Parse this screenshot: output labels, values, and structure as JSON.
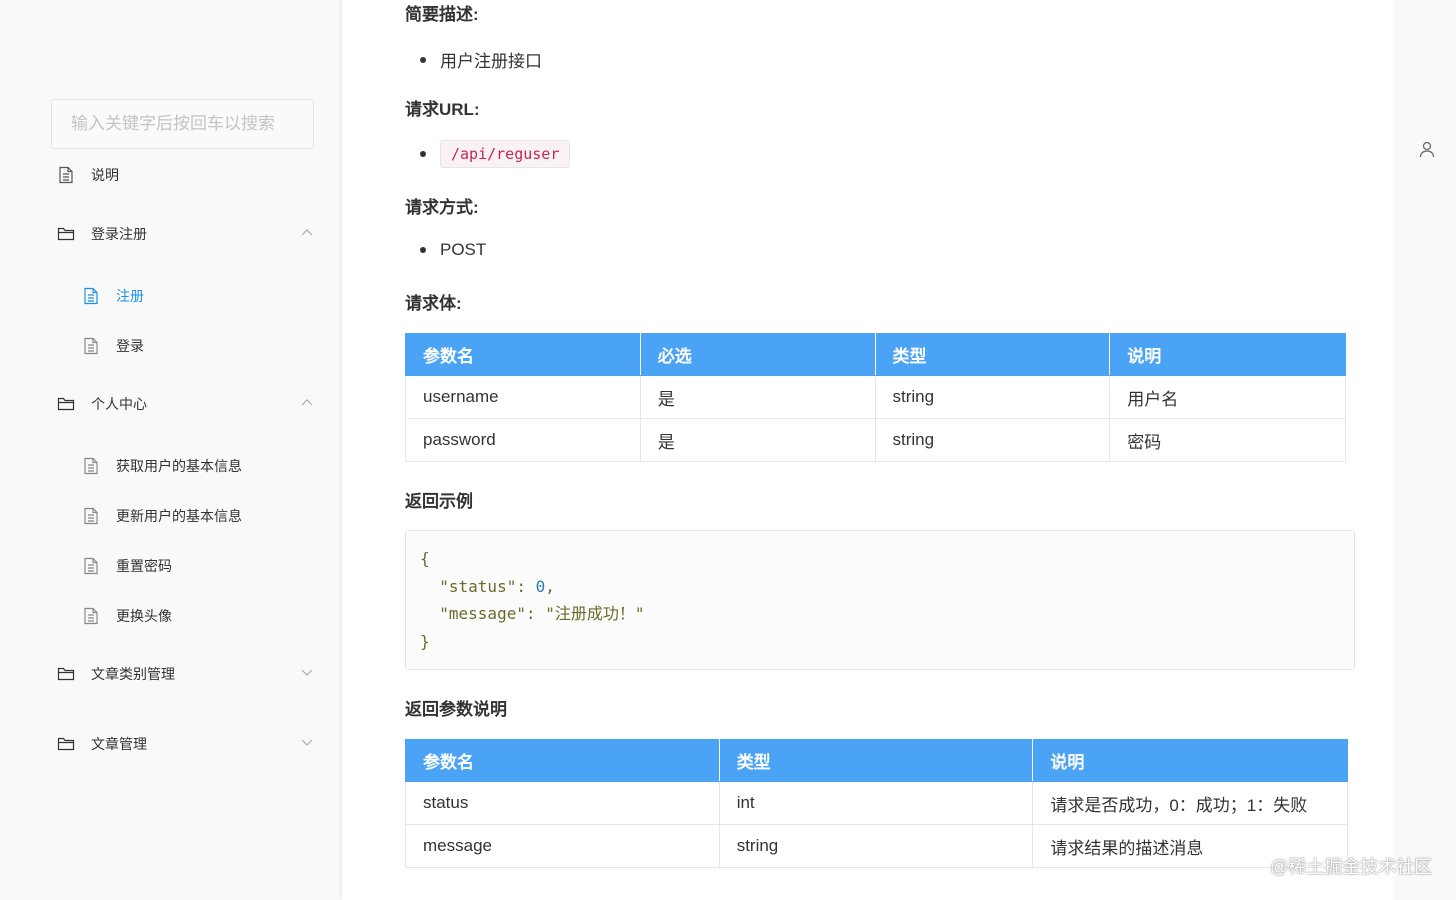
{
  "sidebar": {
    "search_placeholder": "输入关键字后按回车以搜索",
    "items": [
      {
        "label": "说明"
      },
      {
        "label": "登录注册"
      },
      {
        "label": "注册"
      },
      {
        "label": "登录"
      },
      {
        "label": "个人中心"
      },
      {
        "label": "获取用户的基本信息"
      },
      {
        "label": "更新用户的基本信息"
      },
      {
        "label": "重置密码"
      },
      {
        "label": "更换头像"
      },
      {
        "label": "文章类别管理"
      },
      {
        "label": "文章管理"
      }
    ]
  },
  "main": {
    "desc_heading": "简要描述:",
    "desc": "用户注册接口",
    "url_heading": "请求URL:",
    "url": "/api/reguser",
    "method_heading": "请求方式:",
    "method": "POST",
    "body_heading": "请求体:",
    "body_table": {
      "headers": [
        "参数名",
        "必选",
        "类型",
        "说明"
      ],
      "rows": [
        [
          "username",
          "是",
          "string",
          "用户名"
        ],
        [
          "password",
          "是",
          "string",
          "密码"
        ]
      ]
    },
    "example_heading": "返回示例",
    "example_code": {
      "open": "{",
      "l1_key": "  \"status\": ",
      "l1_val": "0",
      "l1_end": ",",
      "l2": "  \"message\": \"注册成功！\"",
      "close": "}"
    },
    "return_heading": "返回参数说明",
    "return_table": {
      "headers": [
        "参数名",
        "类型",
        "说明"
      ],
      "rows": [
        [
          "status",
          "int",
          "请求是否成功，0：成功；1：失败"
        ],
        [
          "message",
          "string",
          "请求结果的描述消息"
        ]
      ]
    }
  },
  "watermark": "@稀土掘金技术社区"
}
